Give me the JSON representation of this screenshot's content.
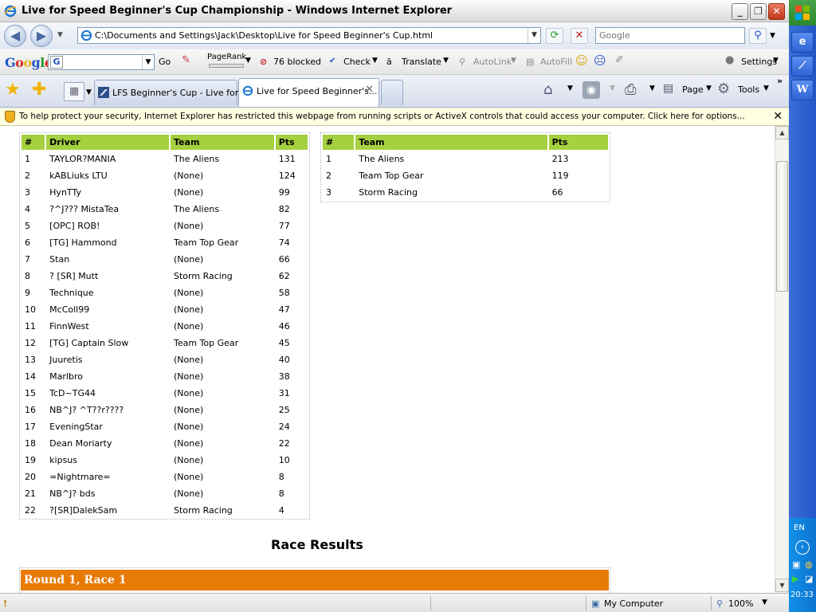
{
  "window": {
    "title": "Live for Speed Beginner's Cup Championship - Windows Internet Explorer"
  },
  "address": {
    "url": "C:\\Documents and Settings\\Jack\\Desktop\\Live for Speed Beginner's Cup.html",
    "search_placeholder": "Google"
  },
  "google_toolbar": {
    "logo": "Google",
    "go": "Go",
    "pagerank": "PageRank",
    "blocked": "76 blocked",
    "check": "Check",
    "translate": "Translate",
    "autolink": "AutoLink",
    "autofill": "AutoFill",
    "settings": "Settings"
  },
  "tabs": [
    {
      "label": "LFS Beginner's Cup - Live for ..."
    },
    {
      "label": "Live for Speed Beginner's..."
    }
  ],
  "commands": {
    "page": "Page",
    "tools": "Tools"
  },
  "infobar": {
    "message": "To help protect your security, Internet Explorer has restricted this webpage from running scripts or ActiveX controls that could access your computer. Click here for options..."
  },
  "driver_standings": {
    "headers": [
      "#",
      "Driver",
      "Team",
      "Pts"
    ],
    "rows": [
      [
        "1",
        "TAYLOR?MANIA",
        "The Aliens",
        "131"
      ],
      [
        "2",
        "kABLiuks LTU",
        "(None)",
        "124"
      ],
      [
        "3",
        "HynTTy",
        "(None)",
        "99"
      ],
      [
        "4",
        "?^J??? MistaTea",
        "The Aliens",
        "82"
      ],
      [
        "5",
        "[OPC] ROB!",
        "(None)",
        "77"
      ],
      [
        "6",
        "[TG] Hammond",
        "Team Top Gear",
        "74"
      ],
      [
        "7",
        "Stan",
        "(None)",
        "66"
      ],
      [
        "8",
        "? [SR] Mutt",
        "Storm Racing",
        "62"
      ],
      [
        "9",
        "Technique",
        "(None)",
        "58"
      ],
      [
        "10",
        "McColl99",
        "(None)",
        "47"
      ],
      [
        "11",
        "FinnWest",
        "(None)",
        "46"
      ],
      [
        "12",
        "[TG] Captain Slow",
        "Team Top Gear",
        "45"
      ],
      [
        "13",
        "Juuretis",
        "(None)",
        "40"
      ],
      [
        "14",
        "Marlbro",
        "(None)",
        "38"
      ],
      [
        "15",
        "TcD~TG44",
        "(None)",
        "31"
      ],
      [
        "16",
        "NB^J? ^T??r????",
        "(None)",
        "25"
      ],
      [
        "17",
        "EveningStar",
        "(None)",
        "24"
      ],
      [
        "18",
        "Dean Moriarty",
        "(None)",
        "22"
      ],
      [
        "19",
        "kipsus",
        "(None)",
        "10"
      ],
      [
        "20",
        "=Nightmare=",
        "(None)",
        "8"
      ],
      [
        "21",
        "NB^J? bds",
        "(None)",
        "8"
      ],
      [
        "22",
        "?[SR]DalekSam",
        "Storm Racing",
        "4"
      ]
    ]
  },
  "team_standings": {
    "headers": [
      "#",
      "Team",
      "Pts"
    ],
    "rows": [
      [
        "1",
        "The Aliens",
        "213"
      ],
      [
        "2",
        "Team Top Gear",
        "119"
      ],
      [
        "3",
        "Storm Racing",
        "66"
      ]
    ]
  },
  "results": {
    "title": "Race Results",
    "round_label": "Round 1, Race 1"
  },
  "statusbar": {
    "zone": "My Computer",
    "zoom": "100%"
  },
  "system": {
    "language": "EN",
    "clock": "20:33"
  },
  "colors": {
    "header_green": "#a5d03f",
    "round_orange": "#e87a06"
  }
}
